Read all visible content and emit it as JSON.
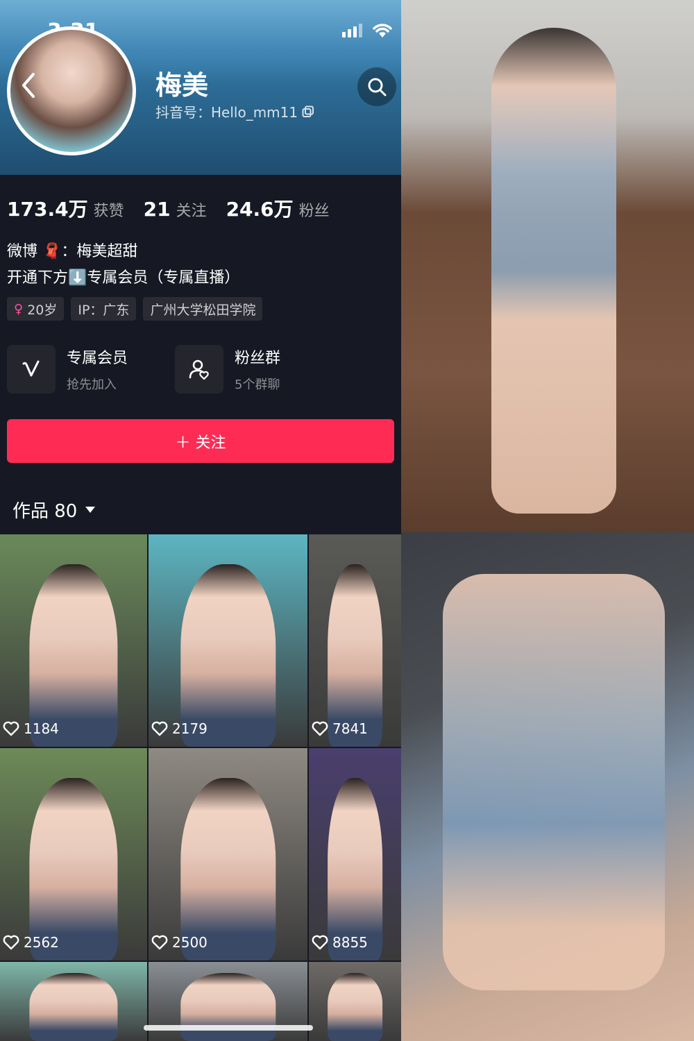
{
  "status_bar": {
    "time": "3:31"
  },
  "profile": {
    "nickname": "梅美",
    "douyin_id": "抖音号：Hello_mm11",
    "stats": [
      {
        "value": "173.4万",
        "label": "获赞"
      },
      {
        "value": "21",
        "label": "关注"
      },
      {
        "value": "24.6万",
        "label": "粉丝"
      }
    ],
    "bio_lines": [
      "微博 🧣：梅美超甜",
      "开通下方⬇️专属会员（专属直播）"
    ],
    "tags": [
      "20岁",
      "IP：广东",
      "广州大学松田学院"
    ],
    "entries": [
      {
        "title": "专属会员",
        "sub": "抢先加入",
        "icon": "v-icon"
      },
      {
        "title": "粉丝群",
        "sub": "5个群聊",
        "icon": "group-icon"
      }
    ],
    "follow_label": "＋ 关注",
    "works_label": "作品 80"
  },
  "videos": [
    {
      "likes": "1184",
      "color": "#6a8a5a"
    },
    {
      "likes": "2179",
      "color": "#5cb6c2"
    },
    {
      "likes": "7841",
      "color": "#5a5a56"
    },
    {
      "likes": "2562",
      "color": "#6d8a58"
    },
    {
      "likes": "2500",
      "color": "#8f8a82"
    },
    {
      "likes": "8855",
      "color": "#4a3f6e"
    },
    {
      "likes": "",
      "color": "#7fb6a8"
    },
    {
      "likes": "",
      "color": "#8a8f94"
    },
    {
      "likes": "",
      "color": "#6e6a66"
    }
  ],
  "colors": {
    "accent": "#fe2c55",
    "background": "#161823"
  }
}
